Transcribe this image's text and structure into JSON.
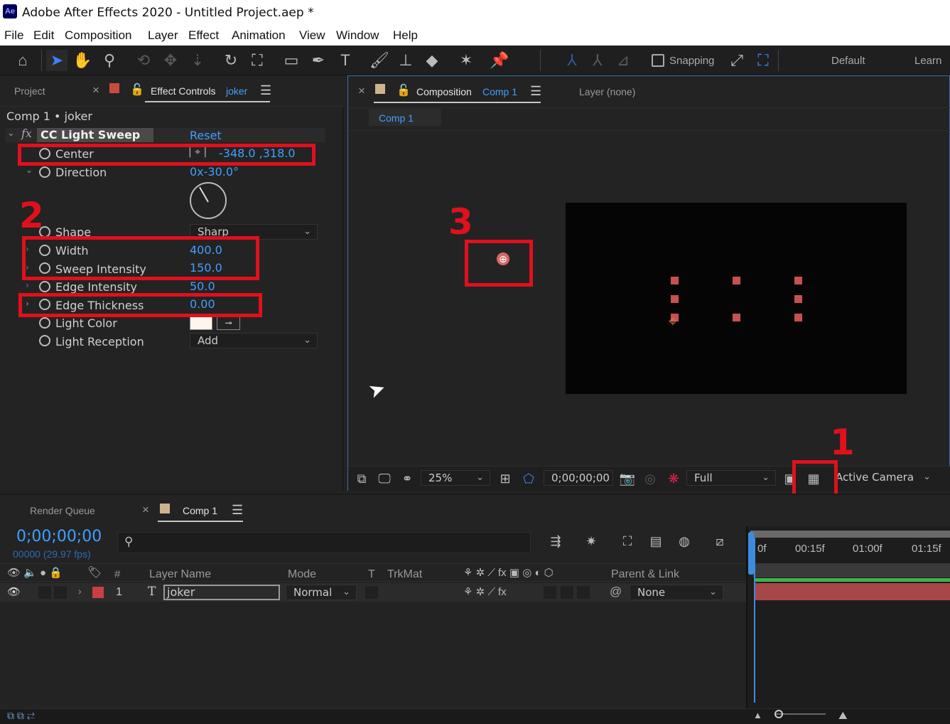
{
  "app": {
    "title": "Adobe After Effects 2020 - Untitled Project.aep *",
    "logo": "Ae"
  },
  "menu": [
    "File",
    "Edit",
    "Composition",
    "Layer",
    "Effect",
    "Animation",
    "View",
    "Window",
    "Help"
  ],
  "toolbar": {
    "snapping": "Snapping",
    "workspace_default": "Default",
    "workspace_learn": "Learn",
    "tools": [
      "home-icon",
      "selection-arrow-icon",
      "hand-icon",
      "zoom-icon",
      "camera-orbit-icon",
      "pan-icon",
      "dolly-icon",
      "rotate-icon",
      "anchor-icon",
      "rectangle-icon",
      "pen-icon",
      "type-icon",
      "brush-icon",
      "clone-stamp-icon",
      "eraser-icon",
      "roto-brush-icon",
      "puppet-pin-icon"
    ]
  },
  "left": {
    "tab_project": "Project",
    "tab_effect_controls": "Effect Controls",
    "tab_layer": "joker",
    "breadcrumb": "Comp 1 • joker",
    "effect_name": "CC Light Sweep",
    "reset": "Reset",
    "props": {
      "center": {
        "label": "Center",
        "value": "-348.0 ,318.0"
      },
      "direction": {
        "label": "Direction",
        "value": "0x-30.0°"
      },
      "shape": {
        "label": "Shape",
        "value": "Sharp"
      },
      "width": {
        "label": "Width",
        "value": "400.0"
      },
      "sweep": {
        "label": "Sweep Intensity",
        "value": "150.0"
      },
      "edge_int": {
        "label": "Edge Intensity",
        "value": "50.0"
      },
      "edge_thick": {
        "label": "Edge Thickness",
        "value": "0.00"
      },
      "light_color": {
        "label": "Light Color",
        "swatch": "#fff5ec"
      },
      "light_rec": {
        "label": "Light Reception",
        "value": "Add"
      }
    }
  },
  "comp": {
    "tab_comp": "Composition",
    "comp_name": "Comp 1",
    "tab_layer": "Layer (none)",
    "subtab": "Comp 1",
    "zoom": "25%",
    "timecode": "0;00;00;00",
    "resolution": "Full",
    "camera": "Active Camera"
  },
  "annotations": {
    "a1": "1",
    "a2": "2",
    "a3": "3"
  },
  "timeline": {
    "tab_render": "Render Queue",
    "tab_comp": "Comp 1",
    "timecode": "0;00;00;00",
    "frames": "00000 (29.97 fps)",
    "cols": {
      "num": "#",
      "layer_name": "Layer Name",
      "mode": "Mode",
      "t": "T",
      "trkmat": "TrkMat",
      "parent": "Parent & Link"
    },
    "ruler": [
      "0f",
      "00:15f",
      "01:00f",
      "01:15f"
    ],
    "layer": {
      "num": "1",
      "type": "T",
      "name": "joker",
      "mode": "Normal",
      "parent": "None"
    }
  },
  "colors": {
    "accent": "#3ea0ff",
    "annotation": "#e0101c",
    "layer_label": "#c84040",
    "bar": "#a84747"
  }
}
